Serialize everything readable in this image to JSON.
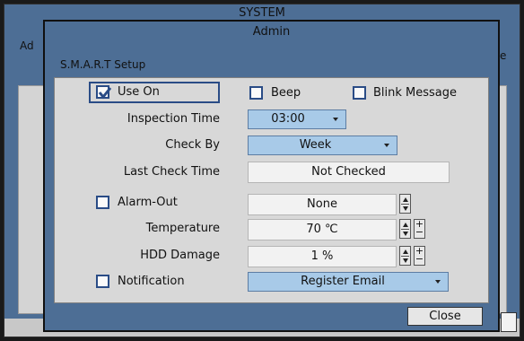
{
  "background": {
    "title": "SYSTEM",
    "left_fragment": "Ad",
    "right_fragment": "e"
  },
  "dialog": {
    "title": "Admin",
    "section_title": "S.M.A.R.T Setup",
    "close_label": "Close"
  },
  "options": {
    "use_on": {
      "label": "Use On",
      "checked": true
    },
    "beep": {
      "label": "Beep",
      "checked": false
    },
    "blink": {
      "label": "Blink Message",
      "checked": false
    }
  },
  "rows": {
    "inspection_time": {
      "label": "Inspection Time",
      "value": "03:00"
    },
    "check_by": {
      "label": "Check By",
      "value": "Week"
    },
    "last_check": {
      "label": "Last Check Time",
      "value": "Not Checked"
    },
    "alarm_out": {
      "label": "Alarm-Out",
      "checked": false,
      "value": "None"
    },
    "temperature": {
      "label": "Temperature",
      "value": "70 ℃"
    },
    "hdd_damage": {
      "label": "HDD Damage",
      "value": "1 %"
    },
    "notification": {
      "label": "Notification",
      "checked": false,
      "value": "Register Email"
    }
  },
  "colors": {
    "window": "#4d6e95",
    "panel": "#d8d8d8",
    "dropdown": "#a8cae8",
    "checkbox_border": "#2a4c86"
  }
}
